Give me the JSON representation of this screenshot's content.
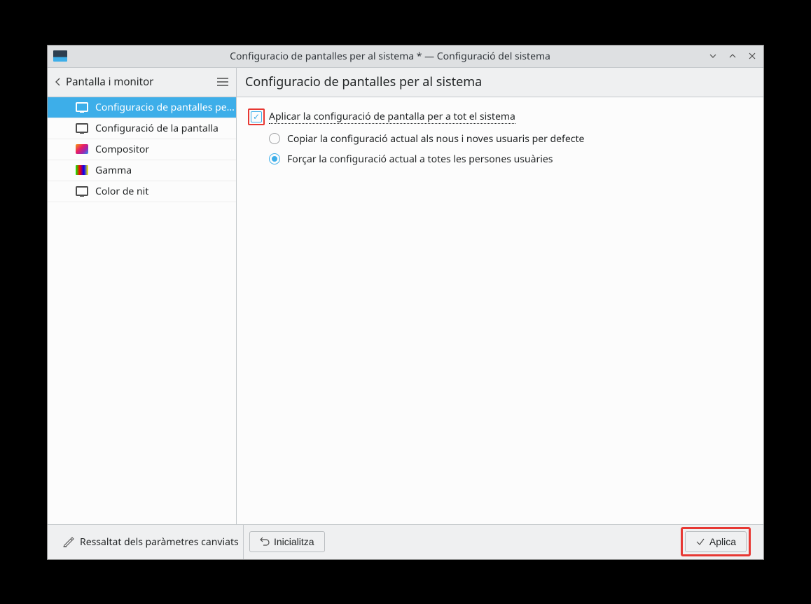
{
  "window": {
    "title": "Configuracio de pantalles per al sistema * — Configuració del sistema"
  },
  "sidebar": {
    "back_label": "Pantalla i monitor",
    "items": [
      {
        "label": "Configuracio de pantalles pe...",
        "icon": "monitor",
        "selected": true
      },
      {
        "label": "Configuració de la pantalla",
        "icon": "monitor",
        "selected": false
      },
      {
        "label": "Compositor",
        "icon": "compositor",
        "selected": false
      },
      {
        "label": "Gamma",
        "icon": "gamma",
        "selected": false
      },
      {
        "label": "Color de nit",
        "icon": "monitor",
        "selected": false
      }
    ]
  },
  "main": {
    "page_title": "Configuracio de pantalles per al sistema",
    "checkbox_label": "Aplicar la configuració de pantalla per a tot el sistema",
    "checkbox_checked": true,
    "radio_options": [
      {
        "label": "Copiar la configuració actual als nous i noves usuaris per defecte",
        "selected": false
      },
      {
        "label": "Forçar la configuració actual a totes les persones usuàries",
        "selected": true
      }
    ]
  },
  "footer": {
    "highlight_label": "Ressaltat dels paràmetres canviats",
    "reset_label": "Inicialitza",
    "apply_label": "Aplica"
  }
}
